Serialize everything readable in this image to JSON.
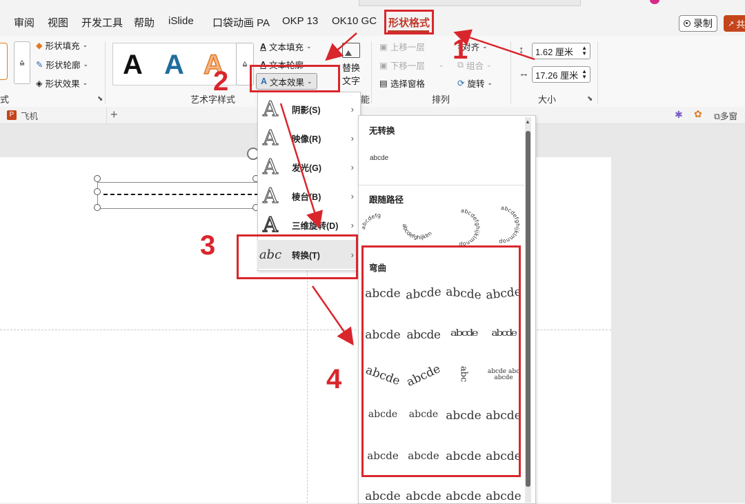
{
  "tabs": [
    "审阅",
    "视图",
    "开发工具",
    "帮助",
    "iSlide",
    "口袋动画 PA",
    "OKP 13",
    "OK10 GC",
    "形状格式"
  ],
  "record_label": "录制",
  "share_label": "共",
  "ribbon": {
    "shape_fill": "形状填充",
    "shape_outline": "形状轮廓",
    "shape_effects": "形状效果",
    "shape_group_label": "式",
    "wordart_letters": [
      "A",
      "A",
      "A"
    ],
    "wordart_group_label": "艺术字样式",
    "text_fill": "文本填充",
    "text_outline": "文本轮廓",
    "text_effects": "文本效果",
    "alt_text_line1": "替换",
    "alt_text_line2": "文字",
    "access_label": "能",
    "bring_forward": "上移一层",
    "send_backward": "下移一层",
    "selection_pane": "选择窗格",
    "align": "对齐",
    "group": "组合",
    "rotate": "旋转",
    "arrange_label": "排列",
    "height": "1.62 厘米",
    "width": "17.26 厘米",
    "size_label": "大小"
  },
  "doc_tab": "飞机",
  "multi_window": "多窗",
  "effects_menu": [
    {
      "label": "阴影(S)",
      "icon": "A"
    },
    {
      "label": "映像(R)",
      "icon": "A"
    },
    {
      "label": "发光(G)",
      "icon": "A"
    },
    {
      "label": "棱台(B)",
      "icon": "A"
    },
    {
      "label": "三维旋转(D)",
      "icon": "A"
    },
    {
      "label": "转换(T)",
      "icon": "abc"
    }
  ],
  "gallery": {
    "no_transform_title": "无转换",
    "no_transform_sample": "abcde",
    "follow_path_title": "跟随路径",
    "follow_path_samples": [
      "abcdefg",
      "abcdefghijklm",
      "abcdefghijklmnop",
      "abcdefghijklmnop"
    ],
    "warp_title": "弯曲",
    "warp_rows": [
      [
        "abcde",
        "abcde",
        "abcde",
        "abcde"
      ],
      [
        "abcde",
        "abcde",
        "abcde",
        "abcde"
      ],
      [
        "abcde",
        "abcde",
        "abc",
        "abcde abc abcde"
      ],
      [
        "abcde",
        "abcde",
        "abcde",
        "abcde"
      ],
      [
        "abcde",
        "abcde",
        "abcde",
        "abcde"
      ],
      [
        "abcde",
        "abcde",
        "abcde",
        "abcde"
      ]
    ]
  },
  "annotations": [
    "1",
    "2",
    "3",
    "4"
  ],
  "colors": {
    "accent": "#c0392b",
    "annotation": "#d9262c"
  }
}
